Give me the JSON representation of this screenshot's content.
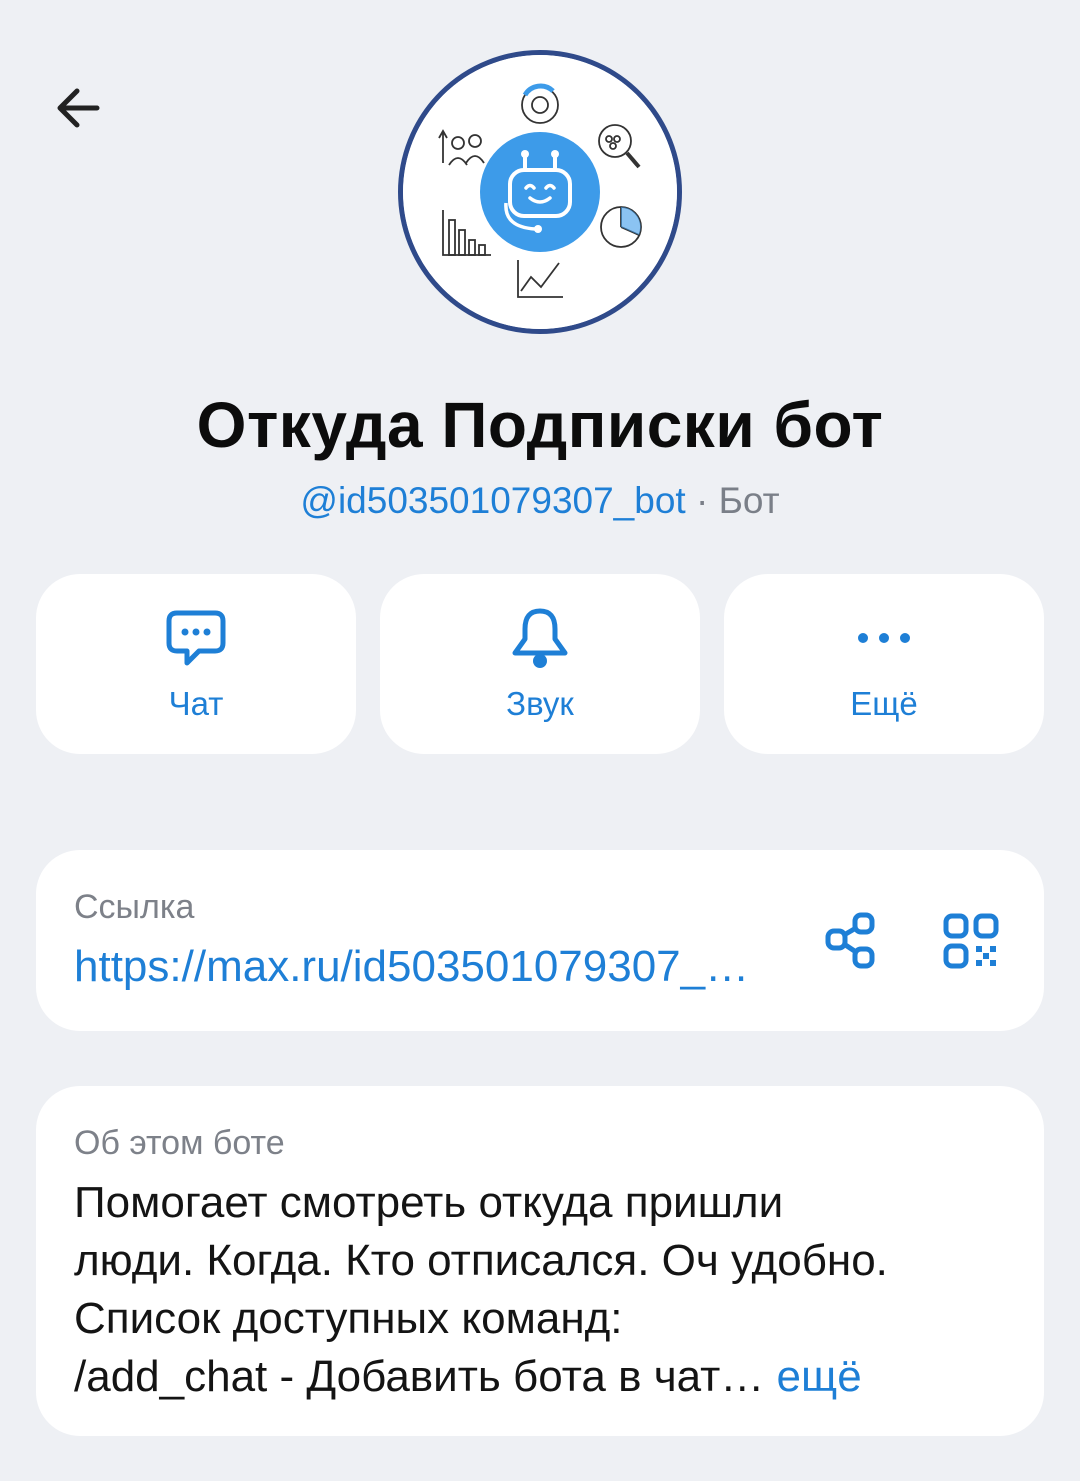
{
  "header": {
    "back_icon": "arrow-left-icon"
  },
  "profile": {
    "name": "Откуда Подписки бот",
    "username": "@id503501079307_bot",
    "separator": "·",
    "kind": "Бот"
  },
  "actions": [
    {
      "label": "Чат",
      "icon": "chat-bubble-icon"
    },
    {
      "label": "Звук",
      "icon": "bell-icon"
    },
    {
      "label": "Ещё",
      "icon": "more-dots-icon"
    }
  ],
  "link_card": {
    "label": "Ссылка",
    "url": "https://max.ru/id503501079307_bot",
    "share_icon": "share-icon",
    "qr_icon": "qr-code-icon"
  },
  "about_card": {
    "label": "Об этом боте",
    "lines": [
      "Помогает смотреть откуда пришли",
      "люди. Когда. Кто отписался. Оч удобно.",
      "Список доступных команд:",
      "/add_chat - Добавить бота в чат…"
    ],
    "more_label": "ещё"
  },
  "colors": {
    "background": "#eef0f4",
    "accent": "#1e7fd6",
    "card": "#ffffff",
    "avatar_ring": "#2f4a8a",
    "avatar_bot": "#3d9be9"
  }
}
